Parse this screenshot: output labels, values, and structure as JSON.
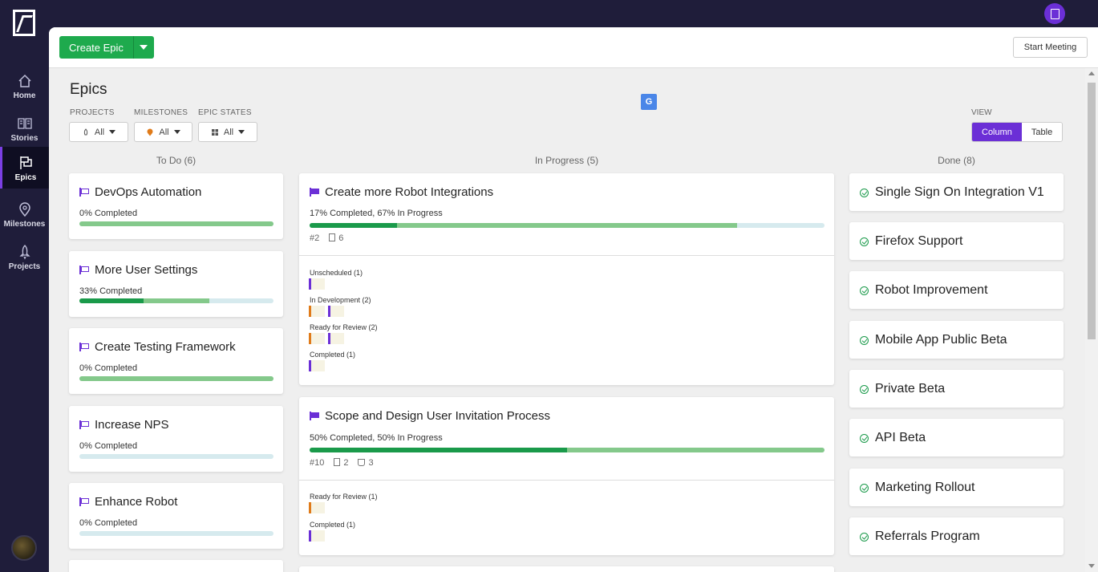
{
  "nav": {
    "items": [
      {
        "label": "Home",
        "icon": "home-icon"
      },
      {
        "label": "Stories",
        "icon": "book-icon"
      },
      {
        "label": "Epics",
        "icon": "epic-flag-icon"
      },
      {
        "label": "Milestones",
        "icon": "map-pin-icon"
      },
      {
        "label": "Projects",
        "icon": "rocket-icon"
      }
    ],
    "active": "Epics"
  },
  "toolbar": {
    "create_label": "Create Epic",
    "start_meeting_label": "Start Meeting"
  },
  "page": {
    "title": "Epics"
  },
  "filters": {
    "projects": {
      "label": "PROJECTS",
      "value": "All"
    },
    "milestones": {
      "label": "MILESTONES",
      "value": "All"
    },
    "epic_states": {
      "label": "EPIC STATES",
      "value": "All"
    }
  },
  "view": {
    "label": "VIEW",
    "options": [
      "Column",
      "Table"
    ],
    "selected": "Column"
  },
  "translate_icon": {
    "glyph": "G"
  },
  "columns": {
    "todo": {
      "header": "To Do (6)",
      "cards": [
        {
          "title": "DevOps Automation",
          "progress": "0% Completed",
          "done_pct": 0,
          "prog_pct": 100
        },
        {
          "title": "More User Settings",
          "progress": "33% Completed",
          "done_pct": 33,
          "prog_pct": 67
        },
        {
          "title": "Create Testing Framework",
          "progress": "0% Completed",
          "done_pct": 0,
          "prog_pct": 100
        },
        {
          "title": "Increase NPS",
          "progress": "0% Completed",
          "done_pct": 0,
          "prog_pct": 0
        },
        {
          "title": "Enhance Robot",
          "progress": "0% Completed",
          "done_pct": 0,
          "prog_pct": 0
        }
      ]
    },
    "in_progress": {
      "header": "In Progress (5)",
      "cards": [
        {
          "title": "Create more Robot Integrations",
          "progress": "17% Completed, 67% In Progress",
          "done_pct": 17,
          "prog_pct": 83,
          "id": "#2",
          "docs": "6",
          "states": [
            {
              "label": "Unscheduled (1)"
            },
            {
              "label": "In Development (2)"
            },
            {
              "label": "Ready for Review (2)"
            },
            {
              "label": "Completed (1)"
            }
          ]
        },
        {
          "title": "Scope and Design User Invitation Process",
          "progress": "50% Completed, 50% In Progress",
          "done_pct": 50,
          "prog_pct": 100,
          "id": "#10",
          "docs": "2",
          "chores": "3",
          "states": [
            {
              "label": "Ready for Review (1)"
            },
            {
              "label": "Completed (1)"
            }
          ]
        }
      ]
    },
    "done": {
      "header": "Done (8)",
      "cards": [
        {
          "title": "Single Sign On Integration V1"
        },
        {
          "title": "Firefox Support"
        },
        {
          "title": "Robot Improvement"
        },
        {
          "title": "Mobile App Public Beta"
        },
        {
          "title": "Private Beta"
        },
        {
          "title": "API Beta"
        },
        {
          "title": "Marketing Rollout"
        },
        {
          "title": "Referrals Program"
        }
      ]
    }
  },
  "colors": {
    "accent": "#6b2fd6",
    "green": "#1eaa4d",
    "nav_bg": "#1f1d3a"
  }
}
